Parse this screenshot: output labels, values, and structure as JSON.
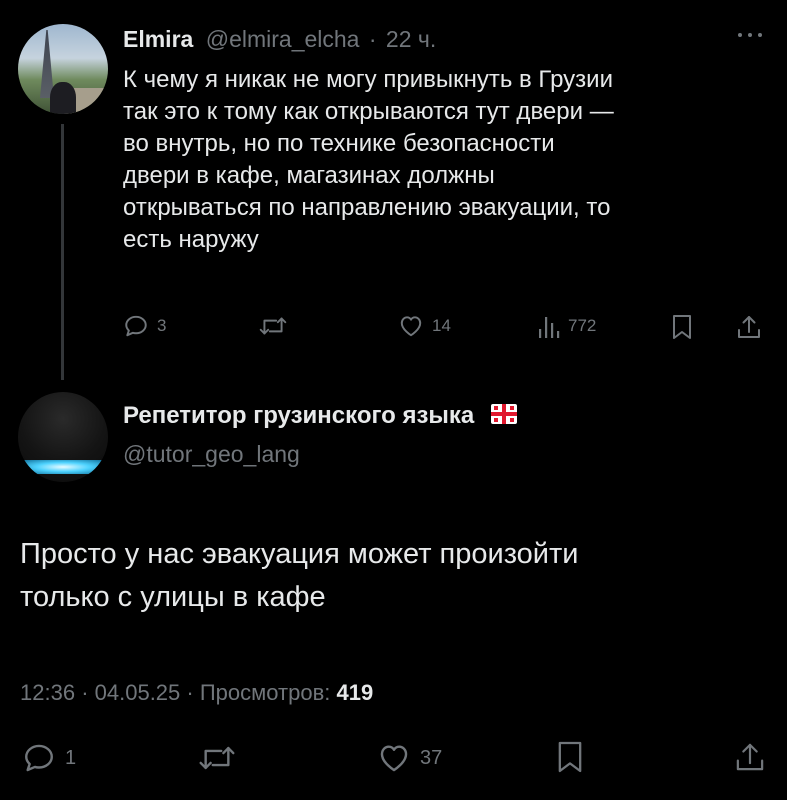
{
  "tweet": {
    "author_name": "Elmira",
    "handle": "@elmira_elcha",
    "separator": "·",
    "time_ago": "22 ч.",
    "more_icon": "more-dots-icon",
    "text_lines": [
      "К чему я никак не могу привыкнуть в Грузии",
      "так это к тому как открываются тут двери —",
      "во внутрь, но по технике безопасности",
      "двери в кафе, магазинах должны",
      "открываться по направлению эвакуации, то",
      "есть наружу"
    ],
    "actions": {
      "replies": "3",
      "likes": "14",
      "views": "772"
    }
  },
  "reply": {
    "author_name": "Репетитор грузинского языка",
    "flag_icon": "georgia-flag-icon",
    "handle": "@tutor_geo_lang",
    "text_lines": [
      "Просто у нас эвакуация может произойти",
      "только с улицы в кафе"
    ],
    "time": "12:36",
    "date": "04.05.25",
    "separator": "·",
    "views_label": "Просмотров:",
    "views_count": "419",
    "actions": {
      "replies": "1",
      "likes": "37"
    }
  },
  "colors": {
    "background": "#000000",
    "text": "#e7e9ea",
    "muted": "#71767b",
    "thread_line": "#333639"
  }
}
